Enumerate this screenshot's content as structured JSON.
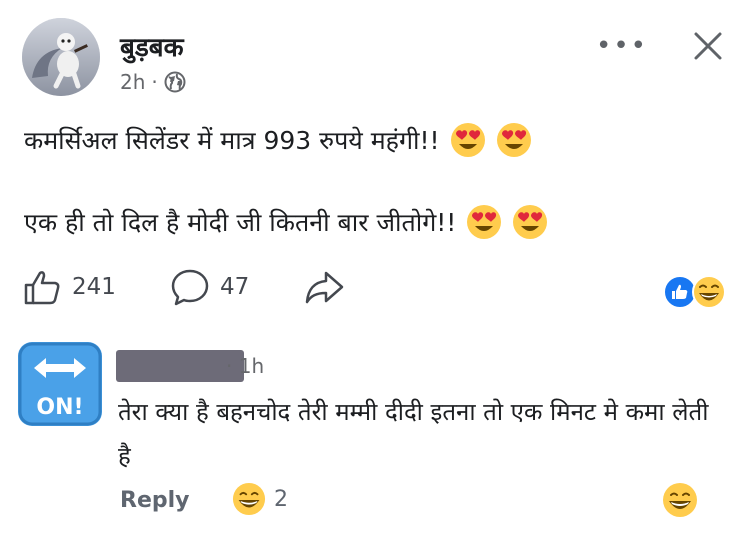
{
  "post": {
    "author": "बुड़बक",
    "time": "2h",
    "separator": "·",
    "more_label": "•••",
    "lines": [
      "कमर्सिअल सिलेंडर में मात्र 993 रुपये महंगी!!",
      "एक ही तो दिल है मोदी जी कितनी बार जीतोगे!!"
    ]
  },
  "actions": {
    "likes": "241",
    "comments": "47"
  },
  "comment": {
    "time": "· 1h",
    "text": "तेरा क्या है बहनचोद तेरी मम्मी दीदी इतना तो एक मिनट मे कमा लेती है",
    "reply_label": "Reply",
    "reaction_count": "2",
    "avatar_label": "ON!"
  },
  "icons": {
    "post_emoji": "heart-eyes-emoji",
    "like": "thumbs-up-icon",
    "comment": "comment-bubble-icon",
    "share": "share-arrow-icon",
    "laugh": "grinning-emoji"
  },
  "colors": {
    "like_blue": "#1877f2",
    "emoji_yellow": "#ffcc4d",
    "heart_red": "#e0283c",
    "on_blue": "#4aa1e8"
  }
}
